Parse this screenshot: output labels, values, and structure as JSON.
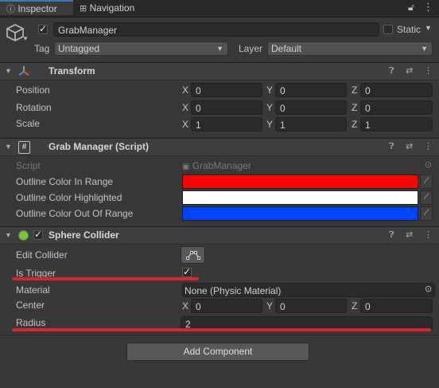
{
  "tabs": {
    "inspector": "Inspector",
    "navigation": "Navigation"
  },
  "header": {
    "object_name": "GrabManager",
    "static_label": "Static",
    "tag_label": "Tag",
    "tag_value": "Untagged",
    "layer_label": "Layer",
    "layer_value": "Default"
  },
  "transform": {
    "title": "Transform",
    "rows": [
      {
        "label": "Position",
        "x": "0",
        "y": "0",
        "z": "0"
      },
      {
        "label": "Rotation",
        "x": "0",
        "y": "0",
        "z": "0"
      },
      {
        "label": "Scale",
        "x": "1",
        "y": "1",
        "z": "1"
      }
    ],
    "axis_x": "X",
    "axis_y": "Y",
    "axis_z": "Z"
  },
  "grab_manager": {
    "title": "Grab Manager (Script)",
    "script_label": "Script",
    "script_value": "GrabManager",
    "colors": [
      {
        "label": "Outline Color In Range",
        "color": "#ff0000"
      },
      {
        "label": "Outline Color Highlighted",
        "color": "#ffffff"
      },
      {
        "label": "Outline Color Out Of Range",
        "color": "#0044ff"
      }
    ]
  },
  "sphere_collider": {
    "title": "Sphere Collider",
    "edit_collider_label": "Edit Collider",
    "is_trigger_label": "Is Trigger",
    "is_trigger_checked": true,
    "material_label": "Material",
    "material_value": "None (Physic Material)",
    "center_label": "Center",
    "center": {
      "x": "0",
      "y": "0",
      "z": "0"
    },
    "radius_label": "Radius",
    "radius_value": "2"
  },
  "add_component_label": "Add Component",
  "annotation_color": "#d7262e",
  "icons": [
    "inspector-tab-icon",
    "navigation-tab-icon",
    "lock-icon",
    "menu-icon",
    "gameobject-cube-icon",
    "transform-axes-icon",
    "script-hash-icon",
    "sphere-collider-icon",
    "help-icon",
    "preset-icon",
    "kebab-menu-icon",
    "eyedropper-icon",
    "edit-collider-icon",
    "object-picker-icon"
  ]
}
